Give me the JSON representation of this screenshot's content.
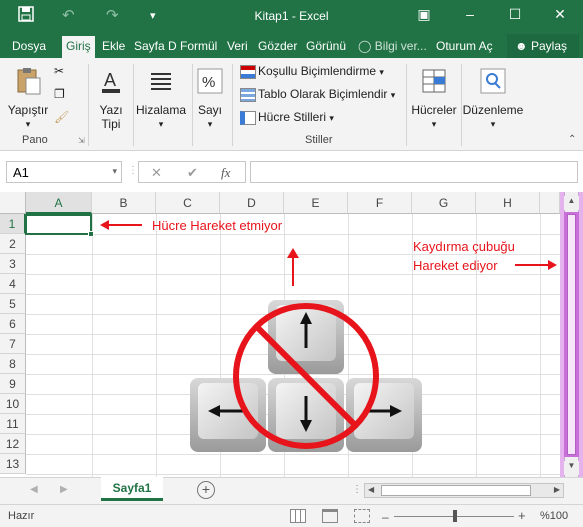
{
  "window": {
    "title": "Kitap1  -  Excel"
  },
  "quick_access": {
    "save": "🖫",
    "undo": "↶",
    "redo": "↷",
    "customize": "▾"
  },
  "window_controls": {
    "ribbon_options": "▣",
    "minimize": "–",
    "maximize": "☐",
    "close": "✕"
  },
  "tabs": [
    "Dosya",
    "Giriş",
    "Ekle",
    "Sayfa D",
    "Formül",
    "Veri",
    "Gözder",
    "Görünü",
    "Bilgi ver...",
    "Oturum Aç",
    "Paylaş"
  ],
  "ribbon": {
    "pano": {
      "paste": "Yapıştır",
      "label": "Pano"
    },
    "font": {
      "label": "Yazı Tipi"
    },
    "alignment": {
      "label": "Hizalama"
    },
    "number": {
      "label": "Sayı"
    },
    "styles": {
      "conditional": "Koşullu Biçimlendirme",
      "table": "Tablo Olarak Biçimlendir",
      "cell_styles": "Hücre Stilleri",
      "label": "Stiller"
    },
    "cells": {
      "label": "Hücreler"
    },
    "editing": {
      "label": "Düzenleme"
    }
  },
  "formula_bar": {
    "name_box": "A1",
    "cancel": "✕",
    "enter": "✔",
    "fx": "fx",
    "value": ""
  },
  "grid": {
    "columns": [
      "A",
      "B",
      "C",
      "D",
      "E",
      "F",
      "G",
      "H"
    ],
    "rows": [
      "1",
      "2",
      "3",
      "4",
      "5",
      "6",
      "7",
      "8",
      "9",
      "10",
      "11",
      "12",
      "13"
    ],
    "active_cell": "A1"
  },
  "annotations": {
    "cell_not_moving": "Hücre Hareket etmiyor",
    "scrollbar_line1": "Kaydırma çubuğu",
    "scrollbar_line2": "Hareket ediyor"
  },
  "sheets": {
    "active": "Sayfa1",
    "add": "+"
  },
  "status": {
    "ready": "Hazır",
    "zoom": "%100",
    "minus": "–",
    "plus": "+"
  },
  "colors": {
    "excel_green": "#217346",
    "annotation_red": "#e8141b",
    "scrollbar_highlight": "#c96fd9"
  }
}
